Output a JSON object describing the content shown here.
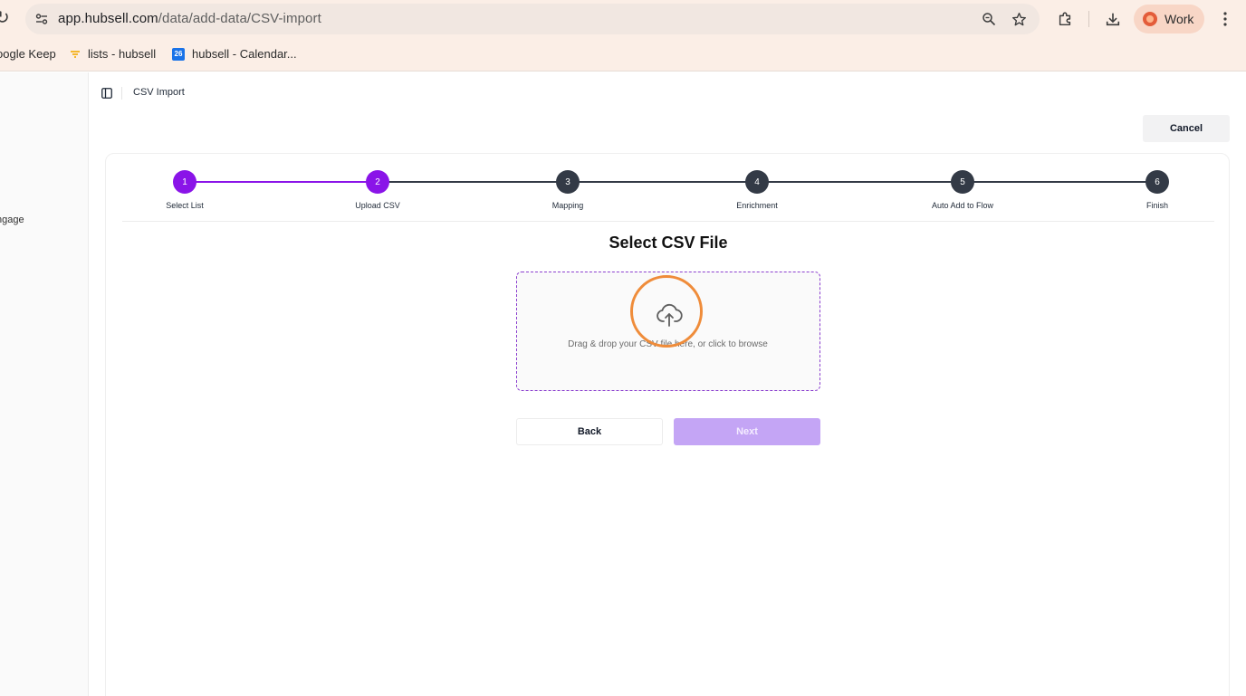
{
  "browser": {
    "reload_glyph": "↻",
    "url_host": "app.hubsell.com",
    "url_path": "/data/add-data/CSV-import",
    "profile_label": "Work",
    "icons": [
      "site-info-icon",
      "zoom-icon",
      "star-icon",
      "extensions-icon",
      "download-icon",
      "menu-icon"
    ]
  },
  "bookmarks": [
    {
      "label": "oogle Keep"
    },
    {
      "label": "lists - hubsell"
    },
    {
      "label": "hubsell - Calendar...",
      "badge": "26"
    }
  ],
  "sidebar": {
    "items": [
      {
        "label": "ngage"
      }
    ]
  },
  "header": {
    "breadcrumb": "CSV Import",
    "cancel_label": "Cancel"
  },
  "stepper": {
    "current": 2,
    "steps": [
      {
        "number": "1",
        "label": "Select List",
        "state": "done"
      },
      {
        "number": "2",
        "label": "Upload CSV",
        "state": "current"
      },
      {
        "number": "3",
        "label": "Mapping",
        "state": "pending"
      },
      {
        "number": "4",
        "label": "Enrichment",
        "state": "pending"
      },
      {
        "number": "5",
        "label": "Auto Add to Flow",
        "state": "pending"
      },
      {
        "number": "6",
        "label": "Finish",
        "state": "pending"
      }
    ]
  },
  "upload": {
    "title": "Select CSV File",
    "hint": "Drag & drop your CSV file here, or click to browse",
    "icon": "cloud-upload-icon"
  },
  "actions": {
    "back_label": "Back",
    "next_label": "Next",
    "next_enabled": false
  },
  "colors": {
    "accent": "#8a14e8",
    "pending": "#333a46",
    "next_disabled": "#c4a5f5",
    "dropzone_border": "#8b3fcf",
    "focus_ring": "#ef8c3a",
    "chrome_bg": "#fbeee6"
  }
}
